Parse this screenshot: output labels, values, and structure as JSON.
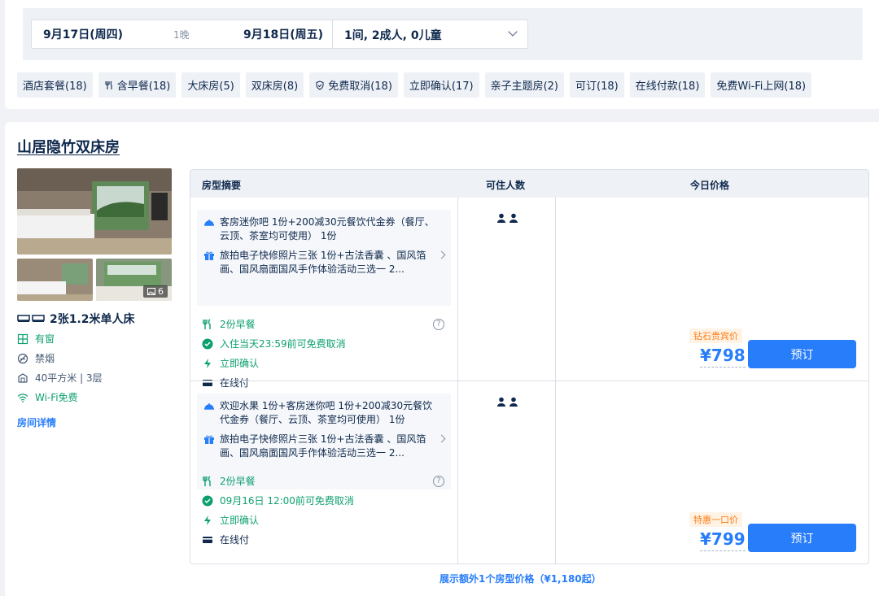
{
  "search": {
    "checkin": "9月17日(周四)",
    "nights": "1晚",
    "checkout": "9月18日(周五)",
    "guests": "1间, 2成人, 0儿童"
  },
  "filters": [
    {
      "label": "酒店套餐(18)",
      "icon": ""
    },
    {
      "label": "含早餐(18)",
      "icon": "utensils-icon"
    },
    {
      "label": "大床房(5)",
      "icon": ""
    },
    {
      "label": "双床房(8)",
      "icon": ""
    },
    {
      "label": "免费取消(18)",
      "icon": "shield-check-icon"
    },
    {
      "label": "立即确认(17)",
      "icon": ""
    },
    {
      "label": "亲子主题房(2)",
      "icon": ""
    },
    {
      "label": "可订(18)",
      "icon": ""
    },
    {
      "label": "在线付款(18)",
      "icon": ""
    },
    {
      "label": "免费Wi-Fi上网(18)",
      "icon": ""
    }
  ],
  "room": {
    "title": "山居隐竹双床房",
    "photo_count": "6",
    "bed": "2张1.2米单人床",
    "amenities": [
      "有窗",
      "禁烟",
      "40平方米 | 3层",
      "Wi-Fi免费"
    ],
    "detail_link": "房间详情"
  },
  "table": {
    "headers": [
      "房型摘要",
      "可住人数",
      "今日价格"
    ],
    "rows": [
      {
        "pkg1": "客房迷你吧 1份+200减30元餐饮代金券（餐厅、云顶、茶室均可使用） 1份",
        "pkg2": "旅拍电子快修照片三张 1份+古法香囊 、国风箔画、国风扇面国风手作体验活动三选一 2...",
        "breakfast": "2份早餐",
        "cancel": "入住当天23:59前可免费取消",
        "confirm": "立即确认",
        "pay": "在线付",
        "tag": "钻石贵宾价",
        "price": "¥798",
        "book": "预订"
      },
      {
        "pkg1": "欢迎水果 1份+客房迷你吧 1份+200减30元餐饮代金券（餐厅、云顶、茶室均可使用） 1份",
        "pkg2": "旅拍电子快修照片三张 1份+古法香囊 、国风箔画、国风扇面国风手作体验活动三选一 2...",
        "breakfast": "2份早餐",
        "cancel": "09月16日 12:00前可免费取消",
        "confirm": "立即确认",
        "pay": "在线付",
        "tag": "特惠一口价",
        "price": "¥799",
        "book": "预订"
      }
    ],
    "more": "展示额外1个房型价格（¥1,180起）"
  },
  "colors": {
    "accent": "#287dfa",
    "green": "#0d9f70",
    "orange": "#ff7d13",
    "navy": "#0f294d"
  }
}
